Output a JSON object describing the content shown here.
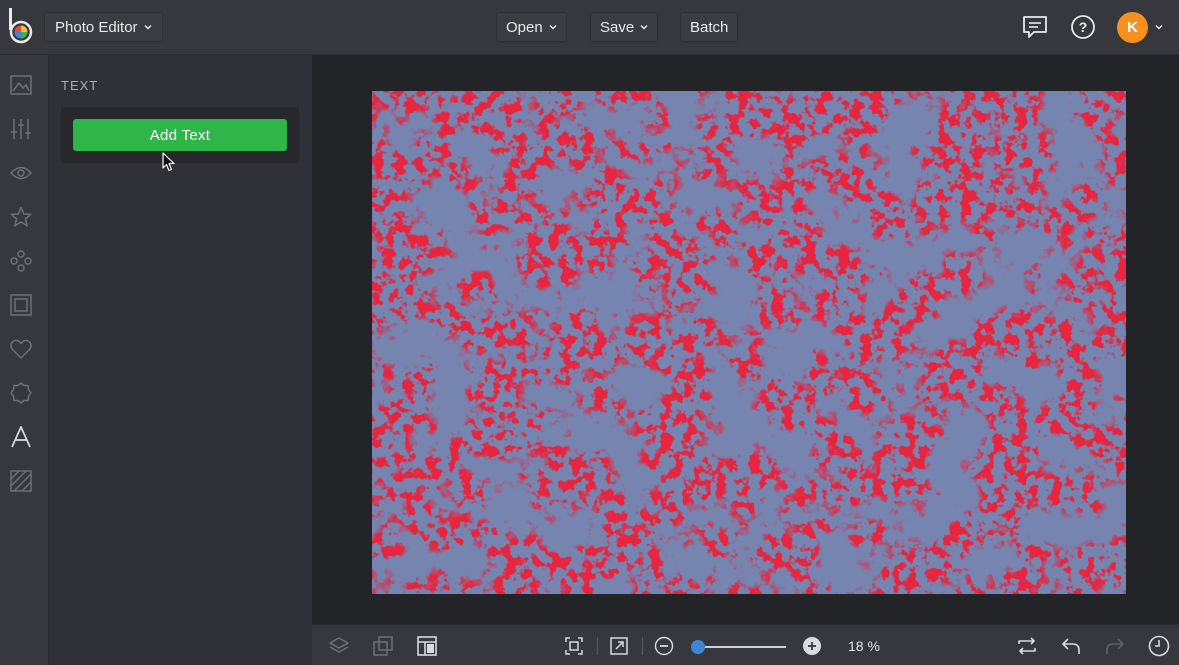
{
  "topbar": {
    "app_name": "Photo Editor",
    "menu": {
      "open": "Open",
      "save": "Save",
      "batch": "Batch"
    },
    "avatar_initial": "K"
  },
  "panel": {
    "title": "TEXT",
    "add_text_label": "Add Text"
  },
  "bottombar": {
    "zoom_label": "18 %",
    "zoom_slider_value": 0.0
  },
  "colors": {
    "accent_green": "#2fb54a",
    "avatar_orange": "#f7901e",
    "slider_blue": "#3d86d6",
    "photo_red": "#e8253f",
    "photo_navy": "#2f3a6d"
  },
  "rail_icons": [
    "image-icon",
    "sliders-icon",
    "eye-icon",
    "star-icon",
    "shapes-icon",
    "frame-icon",
    "heart-icon",
    "badge-icon",
    "text-icon",
    "texture-icon"
  ]
}
